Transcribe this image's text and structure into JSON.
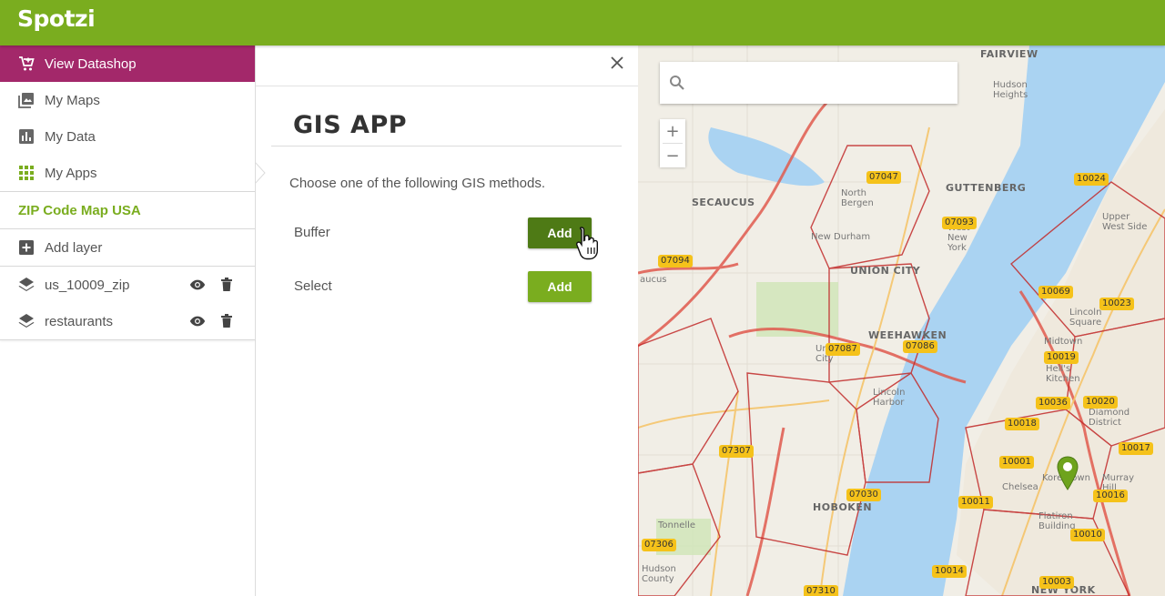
{
  "app": {
    "logo_text": "Spotzi",
    "brand_color": "#7aad1f",
    "accent_color": "#a3286a"
  },
  "sidebar": {
    "nav": [
      {
        "label": "View Datashop",
        "icon": "cart-icon",
        "active": true
      },
      {
        "label": "My Maps",
        "icon": "maps-icon"
      },
      {
        "label": "My Data",
        "icon": "bar-chart-icon"
      },
      {
        "label": "My Apps",
        "icon": "apps-grid-icon"
      }
    ],
    "map_title": "ZIP Code Map USA",
    "add_layer_label": "Add layer",
    "layers": [
      {
        "name": "us_10009_zip"
      },
      {
        "name": "restaurants"
      }
    ]
  },
  "panel": {
    "title": "GIS APP",
    "intro": "Choose one of the following GIS methods.",
    "methods": [
      {
        "label": "Buffer",
        "button": "Add",
        "state": "hover"
      },
      {
        "label": "Select",
        "button": "Add"
      }
    ]
  },
  "map": {
    "search_placeholder": "",
    "zoom_in": "+",
    "zoom_out": "−",
    "places": [
      "FAIRVIEW",
      "Hudson Heights",
      "SECAUCUS",
      "North Bergen",
      "GUTTENBERG",
      "West New York",
      "New Durham",
      "UNION CITY",
      "Upper West Side",
      "Lincoln Square",
      "WEEHAWKEN",
      "Union City",
      "Lincoln Harbor",
      "Midtown",
      "Hell's Kitchen",
      "Diamond District",
      "Chelsea",
      "Koreatown",
      "Murray Hill",
      "HOBOKEN",
      "Flatiron Building",
      "Hudson County",
      "NEW YORK",
      "aucus",
      "Tonnelle"
    ],
    "zips": [
      "07047",
      "10024",
      "07093",
      "07094",
      "10069",
      "10023",
      "07087",
      "07086",
      "10019",
      "10036",
      "10020",
      "10018",
      "10017",
      "07307",
      "10001",
      "10016",
      "10011",
      "07030",
      "10010",
      "07306",
      "10014",
      "10003",
      "07310"
    ]
  }
}
